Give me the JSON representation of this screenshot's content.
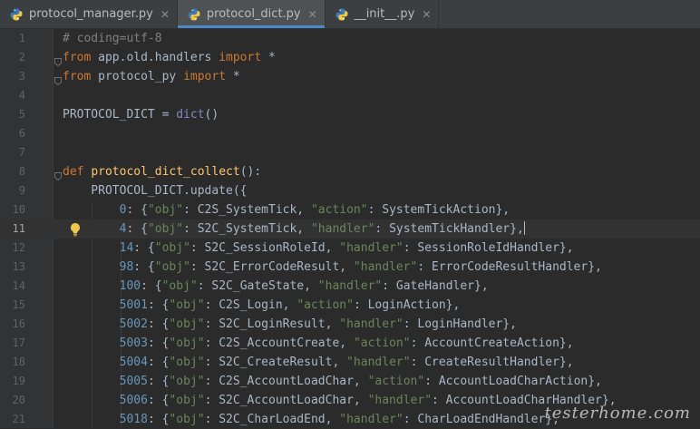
{
  "tabs": [
    {
      "label": "protocol_manager.py",
      "active": false
    },
    {
      "label": "protocol_dict.py",
      "active": true
    },
    {
      "label": "__init__.py",
      "active": false
    }
  ],
  "close_glyph": "✕",
  "current_line": 11,
  "colors": {
    "background": "#2b2b2b",
    "keyword": "#cc7832",
    "function": "#ffc66d",
    "string": "#6a8759",
    "number": "#6897bb",
    "comment": "#808080",
    "identifier": "#a9b7c6",
    "accent": "#4a88c7"
  },
  "lines": [
    {
      "n": 1,
      "tokens": [
        [
          "comment",
          "# coding=utf-8"
        ]
      ]
    },
    {
      "n": 2,
      "fold": true,
      "tokens": [
        [
          "kw",
          "from"
        ],
        [
          "id",
          " app.old.handlers "
        ],
        [
          "kw",
          "import"
        ],
        [
          "id",
          " *"
        ]
      ]
    },
    {
      "n": 3,
      "fold": true,
      "tokens": [
        [
          "kw",
          "from"
        ],
        [
          "id",
          " protocol_py "
        ],
        [
          "kw",
          "import"
        ],
        [
          "id",
          " *"
        ]
      ]
    },
    {
      "n": 4,
      "tokens": []
    },
    {
      "n": 5,
      "tokens": [
        [
          "id",
          "PROTOCOL_DICT = "
        ],
        [
          "builtin",
          "dict"
        ],
        [
          "id",
          "()"
        ]
      ]
    },
    {
      "n": 6,
      "tokens": []
    },
    {
      "n": 7,
      "tokens": []
    },
    {
      "n": 8,
      "fold": true,
      "tokens": [
        [
          "kw",
          "def "
        ],
        [
          "fn",
          "protocol_dict_collect"
        ],
        [
          "id",
          "():"
        ]
      ]
    },
    {
      "n": 9,
      "tokens": [
        [
          "id",
          "    PROTOCOL_DICT.update({"
        ]
      ]
    },
    {
      "n": 10,
      "tokens": [
        [
          "id",
          "        "
        ],
        [
          "num",
          "0"
        ],
        [
          "id",
          ": {"
        ],
        [
          "str",
          "\"obj\""
        ],
        [
          "id",
          ": C2S_SystemTick, "
        ],
        [
          "str",
          "\"action\""
        ],
        [
          "id",
          ": SystemTickAction},"
        ]
      ]
    },
    {
      "n": 11,
      "bulb": true,
      "caret": true,
      "tokens": [
        [
          "id",
          "        "
        ],
        [
          "num",
          "4"
        ],
        [
          "id",
          ": {"
        ],
        [
          "str",
          "\"obj\""
        ],
        [
          "id",
          ": S2C_SystemTick, "
        ],
        [
          "str",
          "\"handler\""
        ],
        [
          "id",
          ": SystemTickHandler},"
        ]
      ]
    },
    {
      "n": 12,
      "tokens": [
        [
          "id",
          "        "
        ],
        [
          "num",
          "14"
        ],
        [
          "id",
          ": {"
        ],
        [
          "str",
          "\"obj\""
        ],
        [
          "id",
          ": S2C_SessionRoleId, "
        ],
        [
          "str",
          "\"handler\""
        ],
        [
          "id",
          ": SessionRoleIdHandler},"
        ]
      ]
    },
    {
      "n": 13,
      "tokens": [
        [
          "id",
          "        "
        ],
        [
          "num",
          "98"
        ],
        [
          "id",
          ": {"
        ],
        [
          "str",
          "\"obj\""
        ],
        [
          "id",
          ": S2C_ErrorCodeResult, "
        ],
        [
          "str",
          "\"handler\""
        ],
        [
          "id",
          ": ErrorCodeResultHandler},"
        ]
      ]
    },
    {
      "n": 14,
      "tokens": [
        [
          "id",
          "        "
        ],
        [
          "num",
          "100"
        ],
        [
          "id",
          ": {"
        ],
        [
          "str",
          "\"obj\""
        ],
        [
          "id",
          ": S2C_GateState, "
        ],
        [
          "str",
          "\"handler\""
        ],
        [
          "id",
          ": GateHandler},"
        ]
      ]
    },
    {
      "n": 15,
      "tokens": [
        [
          "id",
          "        "
        ],
        [
          "num",
          "5001"
        ],
        [
          "id",
          ": {"
        ],
        [
          "str",
          "\"obj\""
        ],
        [
          "id",
          ": C2S_Login, "
        ],
        [
          "str",
          "\"action\""
        ],
        [
          "id",
          ": LoginAction},"
        ]
      ]
    },
    {
      "n": 16,
      "tokens": [
        [
          "id",
          "        "
        ],
        [
          "num",
          "5002"
        ],
        [
          "id",
          ": {"
        ],
        [
          "str",
          "\"obj\""
        ],
        [
          "id",
          ": S2C_LoginResult, "
        ],
        [
          "str",
          "\"handler\""
        ],
        [
          "id",
          ": LoginHandler},"
        ]
      ]
    },
    {
      "n": 17,
      "tokens": [
        [
          "id",
          "        "
        ],
        [
          "num",
          "5003"
        ],
        [
          "id",
          ": {"
        ],
        [
          "str",
          "\"obj\""
        ],
        [
          "id",
          ": C2S_AccountCreate, "
        ],
        [
          "str",
          "\"action\""
        ],
        [
          "id",
          ": AccountCreateAction},"
        ]
      ]
    },
    {
      "n": 18,
      "tokens": [
        [
          "id",
          "        "
        ],
        [
          "num",
          "5004"
        ],
        [
          "id",
          ": {"
        ],
        [
          "str",
          "\"obj\""
        ],
        [
          "id",
          ": S2C_CreateResult, "
        ],
        [
          "str",
          "\"handler\""
        ],
        [
          "id",
          ": CreateResultHandler},"
        ]
      ]
    },
    {
      "n": 19,
      "tokens": [
        [
          "id",
          "        "
        ],
        [
          "num",
          "5005"
        ],
        [
          "id",
          ": {"
        ],
        [
          "str",
          "\"obj\""
        ],
        [
          "id",
          ": C2S_AccountLoadChar, "
        ],
        [
          "str",
          "\"action\""
        ],
        [
          "id",
          ": AccountLoadCharAction},"
        ]
      ]
    },
    {
      "n": 20,
      "tokens": [
        [
          "id",
          "        "
        ],
        [
          "num",
          "5006"
        ],
        [
          "id",
          ": {"
        ],
        [
          "str",
          "\"obj\""
        ],
        [
          "id",
          ": S2C_AccountLoadChar, "
        ],
        [
          "str",
          "\"handler\""
        ],
        [
          "id",
          ": AccountLoadCharHandler},"
        ]
      ]
    },
    {
      "n": 21,
      "tokens": [
        [
          "id",
          "        "
        ],
        [
          "num",
          "5018"
        ],
        [
          "id",
          ": {"
        ],
        [
          "str",
          "\"obj\""
        ],
        [
          "id",
          ": S2C_CharLoadEnd, "
        ],
        [
          "str",
          "\"handler\""
        ],
        [
          "id",
          ": CharLoadEndHandler},"
        ]
      ]
    }
  ],
  "watermark": "testerhome.com"
}
